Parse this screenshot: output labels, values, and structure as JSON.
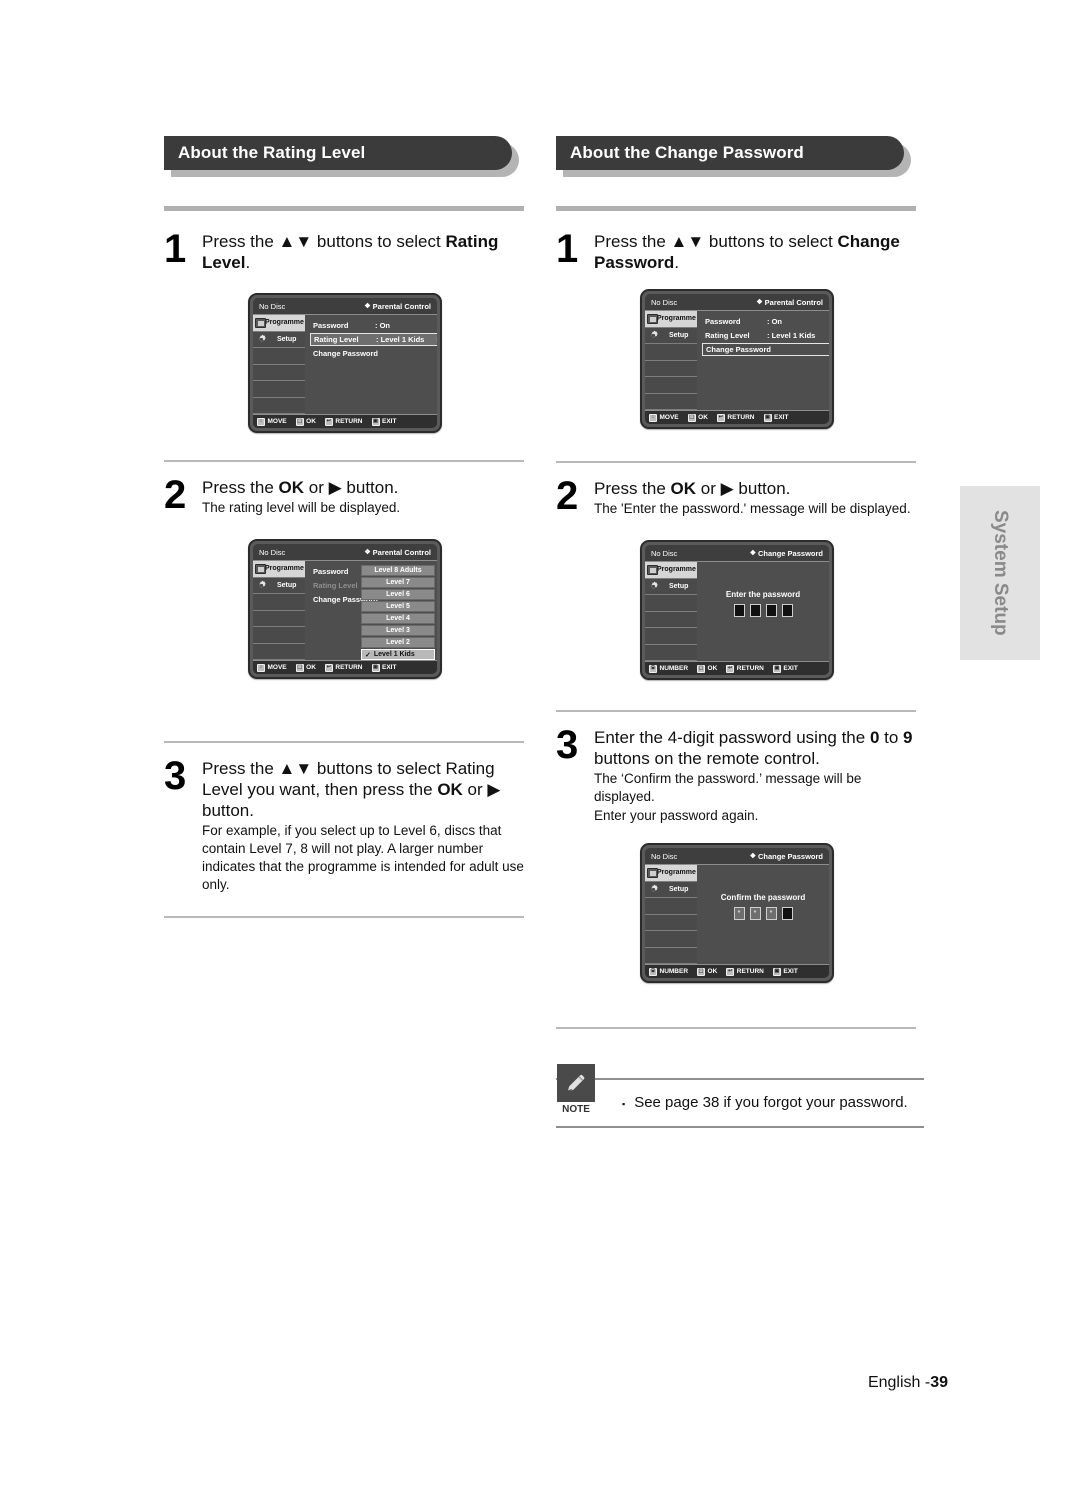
{
  "left": {
    "banner": "About the Rating Level",
    "steps": [
      {
        "num": "1",
        "main_a": "Press the ",
        "arrows": "▲▼",
        "main_b": " buttons to select ",
        "main_bold": "Rating Level",
        "main_c": ".",
        "sub": ""
      },
      {
        "num": "2",
        "main_a": "Press the ",
        "main_bold": "OK",
        "main_b": " or ",
        "arrow": "▶",
        "main_c": " button.",
        "sub": "The rating level will be displayed."
      },
      {
        "num": "3",
        "main_a": "Press the ",
        "arrows": "▲▼",
        "main_b": " buttons to select Rating Level you want, then press the ",
        "main_bold": "OK",
        "main_c": " or ",
        "arrow": "▶",
        "main_d": " button.",
        "sub": "For example, if you select up to Level 6, discs that contain Level 7, 8 will not play. A larger number indicates that the programme is intended for adult use only."
      }
    ]
  },
  "right": {
    "banner": "About the Change Password",
    "steps": [
      {
        "num": "1",
        "main_a": "Press the ",
        "arrows": "▲▼",
        "main_b": " buttons to select ",
        "main_bold": "Change Password",
        "main_c": ".",
        "sub": ""
      },
      {
        "num": "2",
        "main_a": "Press the ",
        "main_bold": "OK",
        "main_b": " or ",
        "arrow": "▶",
        "main_c": " button.",
        "sub": "The 'Enter the password.' message will be displayed."
      },
      {
        "num": "3",
        "main_a": "Enter the 4-digit password using the ",
        "main_bold": "0",
        "main_b": " to ",
        "main_bold2": "9",
        "main_c": " buttons on the remote control.",
        "sub": "The ‘Confirm the password.’ message will be displayed.",
        "sub2": "Enter your password again."
      }
    ]
  },
  "tv_screens": {
    "rating_menu": {
      "status": "No Disc",
      "title": "Parental Control",
      "diamond": "❖",
      "sidebar": [
        "Programme",
        "Setup"
      ],
      "rows": [
        {
          "label": "Password",
          "value": ": On",
          "arrow": "▸",
          "state": "normal"
        },
        {
          "label": "Rating Level",
          "value": ": Level 1 Kids",
          "arrow": "▸",
          "state": "highlight"
        },
        {
          "label": "Change Password",
          "value": "",
          "arrow": "▸",
          "state": "normal"
        }
      ],
      "footer": [
        {
          "key": "↕",
          "label": "MOVE"
        },
        {
          "key": "⬚",
          "label": "OK"
        },
        {
          "key": "↩",
          "label": "RETURN"
        },
        {
          "key": "▣",
          "label": "EXIT"
        }
      ]
    },
    "rating_levels": {
      "status": "No Disc",
      "title": "Parental Control",
      "diamond": "❖",
      "sidebar": [
        "Programme",
        "Setup"
      ],
      "rows": [
        {
          "label": "Password",
          "state": "normal"
        },
        {
          "label": "Rating Level",
          "state": "dim"
        },
        {
          "label": "Change Password",
          "state": "normal"
        }
      ],
      "levels": [
        {
          "label": "Level 8 Adults",
          "selected": false
        },
        {
          "label": "Level 7",
          "selected": false
        },
        {
          "label": "Level 6",
          "selected": false
        },
        {
          "label": "Level 5",
          "selected": false
        },
        {
          "label": "Level 4",
          "selected": false
        },
        {
          "label": "Level 3",
          "selected": false
        },
        {
          "label": "Level 2",
          "selected": false
        },
        {
          "label": "Level 1 Kids",
          "selected": true
        }
      ],
      "check": "✓",
      "footer": [
        {
          "key": "↕",
          "label": "MOVE"
        },
        {
          "key": "⬚",
          "label": "OK"
        },
        {
          "key": "↩",
          "label": "RETURN"
        },
        {
          "key": "▣",
          "label": "EXIT"
        }
      ]
    },
    "password_menu": {
      "status": "No Disc",
      "title": "Parental Control",
      "diamond": "❖",
      "sidebar": [
        "Programme",
        "Setup"
      ],
      "rows": [
        {
          "label": "Password",
          "value": ": On",
          "arrow": "▸",
          "state": "normal"
        },
        {
          "label": "Rating Level",
          "value": ": Level 1 Kids",
          "arrow": "▸",
          "state": "normal"
        },
        {
          "label": "Change Password",
          "value": "",
          "arrow": "▸",
          "state": "outline"
        }
      ],
      "footer": [
        {
          "key": "↕",
          "label": "MOVE"
        },
        {
          "key": "⬚",
          "label": "OK"
        },
        {
          "key": "↩",
          "label": "RETURN"
        },
        {
          "key": "▣",
          "label": "EXIT"
        }
      ]
    },
    "enter_password": {
      "status": "No Disc",
      "title": "Change Password",
      "diamond": "❖",
      "sidebar": [
        "Programme",
        "Setup"
      ],
      "prompt": "Enter the password",
      "boxes": [
        "",
        "",
        "",
        ""
      ],
      "footer": [
        {
          "key": "⌸",
          "label": "NUMBER"
        },
        {
          "key": "⬚",
          "label": "OK"
        },
        {
          "key": "↩",
          "label": "RETURN"
        },
        {
          "key": "▣",
          "label": "EXIT"
        }
      ]
    },
    "confirm_password": {
      "status": "No Disc",
      "title": "Change Password",
      "diamond": "❖",
      "sidebar": [
        "Programme",
        "Setup"
      ],
      "prompt": "Confirm the password",
      "boxes": [
        "*",
        "*",
        "*",
        ""
      ],
      "footer": [
        {
          "key": "⌸",
          "label": "NUMBER"
        },
        {
          "key": "⬚",
          "label": "OK"
        },
        {
          "key": "↩",
          "label": "RETURN"
        },
        {
          "key": "▣",
          "label": "EXIT"
        }
      ]
    }
  },
  "side_tab": {
    "label": "System Setup"
  },
  "note": {
    "badge_label": "NOTE",
    "bullet": "▪",
    "text": "See page 38 if you forgot your password."
  },
  "footer": {
    "language": "English -",
    "page": "39"
  }
}
